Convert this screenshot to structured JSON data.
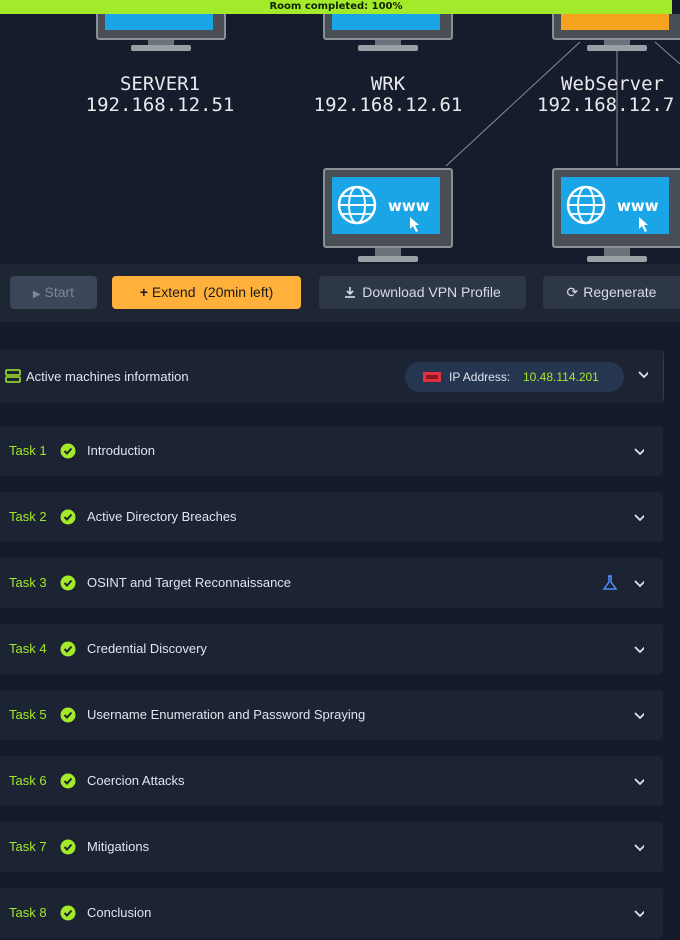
{
  "banner": {
    "text": "Room completed: 100%"
  },
  "network": {
    "nodes": [
      {
        "name": "SERVER1",
        "ip": "192.168.12.51"
      },
      {
        "name": "WRK",
        "ip": "192.168.12.61"
      },
      {
        "name": "WebServer",
        "ip": "192.168.12.7"
      }
    ],
    "web_nodes": [
      {
        "label": "www"
      },
      {
        "label": "www"
      }
    ],
    "colors": {
      "screen_blue": "#1aa6e6",
      "screen_orange": "#f5a21c"
    }
  },
  "toolbar": {
    "start_label": "Start",
    "extend_label": "Extend  (20min left)",
    "vpn_label": "Download VPN Profile",
    "regen_label": "Regenerate"
  },
  "active_machines": {
    "title": "Active machines information",
    "ip_label": "IP Address:",
    "ip_value": "10.48.114.201"
  },
  "tasks": [
    {
      "num": "Task 1",
      "title": "Introduction"
    },
    {
      "num": "Task 2",
      "title": "Active Directory Breaches"
    },
    {
      "num": "Task 3",
      "title": "OSINT and Target Reconnaissance"
    },
    {
      "num": "Task 4",
      "title": "Credential Discovery"
    },
    {
      "num": "Task 5",
      "title": "Username Enumeration and Password Spraying"
    },
    {
      "num": "Task 6",
      "title": "Coercion Attacks"
    },
    {
      "num": "Task 7",
      "title": "Mitigations"
    },
    {
      "num": "Task 8",
      "title": "Conclusion"
    }
  ],
  "icons": {
    "start": "play-icon",
    "extend": "plus-icon",
    "vpn": "download-icon",
    "regen": "refresh-icon",
    "active": "server-icon",
    "task_complete": "check-circle-icon",
    "expand": "chevron-down-icon",
    "task3_extra": "flask-icon"
  },
  "accent": {
    "green": "#a3ea2a",
    "orange": "#ffb13b"
  }
}
